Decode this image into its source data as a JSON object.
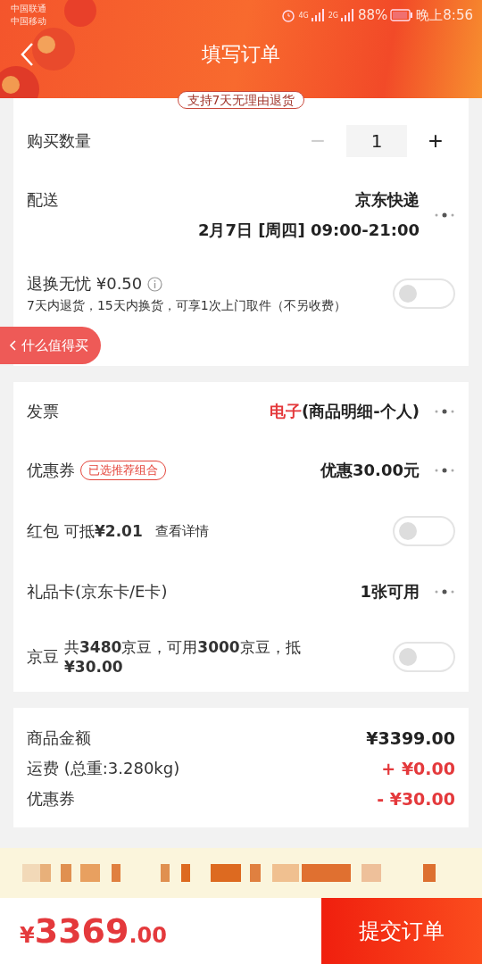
{
  "status_bar": {
    "carriers": [
      "中国联通",
      "中国移动"
    ],
    "networks": [
      "4G",
      "2G"
    ],
    "battery": "88%",
    "time": "晚上8:56"
  },
  "header": {
    "title": "填写订单"
  },
  "return_badge": "支持7天无理由退货",
  "quantity": {
    "label": "购买数量",
    "minus": "−",
    "minus_disabled": true,
    "value": "1",
    "plus": "+"
  },
  "delivery": {
    "label": "配送",
    "carrier": "京东快递",
    "time": "2月7日 [周四] 09:00-21:00"
  },
  "return_service": {
    "title": "退换无忧 ¥0.50",
    "description": "7天内退货，15天内换货，可享1次上门取件（不另收费）",
    "on": false
  },
  "floating_tab": "什么值得买",
  "options": [
    {
      "kind": "link",
      "label": "发票",
      "value_highlight": "电子",
      "value": "(商品明细-个人)"
    },
    {
      "kind": "link",
      "label": "优惠券",
      "tag": "已选推荐组合",
      "value": "优惠30.00元"
    },
    {
      "kind": "toggle",
      "label": "红包",
      "detail": "可抵**¥2.01**",
      "link": "查看详情",
      "on": false
    },
    {
      "kind": "link",
      "label": "礼品卡(京东卡/E卡)",
      "value": "1张可用"
    },
    {
      "kind": "toggle",
      "label": "京豆",
      "detail": "共**3480**京豆，可用**3000**京豆，抵 **¥30.00**",
      "on": false
    }
  ],
  "summary": [
    {
      "label": "商品金额",
      "amount": "¥3399.00",
      "color": "#222222"
    },
    {
      "label": "运费 (总重:3.280kg)",
      "amount": "+ ¥0.00",
      "color": "#e4393c"
    },
    {
      "label": "优惠券",
      "amount": "- ¥30.00",
      "color": "#e4393c"
    }
  ],
  "footer": {
    "currency": "¥",
    "total_integer": "3369",
    "total_decimal": ".00",
    "submit": "提交订单"
  }
}
